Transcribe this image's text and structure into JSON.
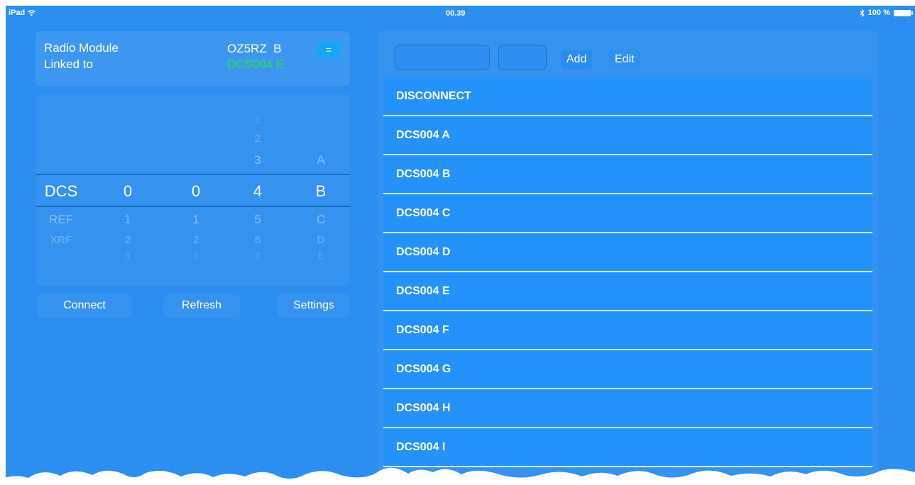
{
  "statusbar": {
    "device": "iPad",
    "time": "00.39",
    "battery": "100 %"
  },
  "module": {
    "label_line1": "Radio Module",
    "label_line2": "Linked to",
    "callsign": "OZ5RZ  B",
    "linked": "DCS004 E",
    "menu_button": "="
  },
  "picker": {
    "col1": {
      "selected": "DCS",
      "below": [
        "REF",
        "XRF"
      ]
    },
    "col2": {
      "selected": "0",
      "below": [
        "1",
        "2",
        "3"
      ]
    },
    "col3": {
      "selected": "0",
      "below": [
        "1",
        "2",
        "3"
      ]
    },
    "col4": {
      "above": [
        "1",
        "2",
        "3"
      ],
      "selected": "4",
      "below": [
        "5",
        "6",
        "7"
      ]
    },
    "col5": {
      "above": [
        "A"
      ],
      "selected": "B",
      "below": [
        "C",
        "D",
        "E"
      ]
    }
  },
  "buttons": {
    "connect": "Connect",
    "refresh": "Refresh",
    "settings": "Settings"
  },
  "reflector": {
    "input1_value": "",
    "input2_value": "",
    "add": "Add",
    "edit": "Edit",
    "items": [
      "DISCONNECT",
      "DCS004 A",
      "DCS004 B",
      "DCS004 C",
      "DCS004 D",
      "DCS004 E",
      "DCS004 F",
      "DCS004 G",
      "DCS004 H",
      "DCS004 I"
    ]
  },
  "colors": {
    "background": "#2b8ef0",
    "linked_green": "#22e244",
    "list_row": "#2592fb"
  }
}
